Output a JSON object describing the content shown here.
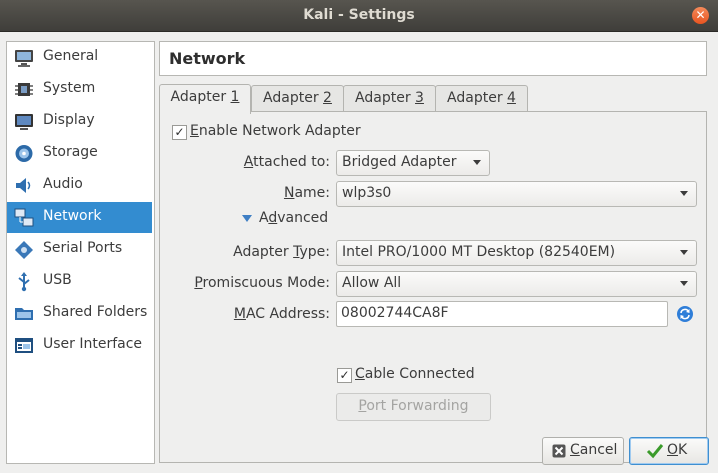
{
  "window": {
    "title": "Kali - Settings",
    "close_glyph": "✕"
  },
  "sidebar": {
    "items": [
      {
        "label": "General",
        "icon": "monitor-general-icon"
      },
      {
        "label": "System",
        "icon": "chip-icon"
      },
      {
        "label": "Display",
        "icon": "display-icon"
      },
      {
        "label": "Storage",
        "icon": "storage-disk-icon"
      },
      {
        "label": "Audio",
        "icon": "speaker-icon"
      },
      {
        "label": "Network",
        "icon": "network-icon",
        "selected": true
      },
      {
        "label": "Serial Ports",
        "icon": "serial-port-icon"
      },
      {
        "label": "USB",
        "icon": "usb-icon"
      },
      {
        "label": "Shared Folders",
        "icon": "folder-icon"
      },
      {
        "label": "User Interface",
        "icon": "user-interface-icon"
      }
    ]
  },
  "section_title": "Network",
  "tabs": [
    {
      "pre": "Adapter ",
      "key": "1",
      "active": true
    },
    {
      "pre": "Adapter ",
      "key": "2"
    },
    {
      "pre": "Adapter ",
      "key": "3"
    },
    {
      "pre": "Adapter ",
      "key": "4"
    }
  ],
  "adapter": {
    "enable_pre": "",
    "enable_key": "E",
    "enable_post": "nable Network Adapter",
    "enabled": true,
    "attached_label_key": "A",
    "attached_label_post": "ttached to:",
    "attached_value": "Bridged Adapter",
    "name_label_key": "N",
    "name_label_post": "ame:",
    "name_value": "wlp3s0",
    "advanced_pre": "A",
    "advanced_key": "d",
    "advanced_post": "vanced",
    "type_label_pre": "Adapter ",
    "type_label_key": "T",
    "type_label_post": "ype:",
    "type_value": "Intel PRO/1000 MT Desktop (82540EM)",
    "promisc_label_key": "P",
    "promisc_label_post": "romiscuous Mode:",
    "promisc_value": "Allow All",
    "mac_label_key": "M",
    "mac_label_post": "AC Address:",
    "mac_value": "08002744CA8F",
    "cable_key": "C",
    "cable_post": "able Connected",
    "cable_connected": true,
    "port_forwarding_key": "P",
    "port_forwarding_post": "ort Forwarding"
  },
  "footer": {
    "cancel_key": "C",
    "cancel_post": "ancel",
    "cancel_icon": "cancel-x-icon",
    "ok_key": "O",
    "ok_post": "K",
    "ok_icon": "ok-check-icon"
  },
  "colors": {
    "selection": "#338cd0",
    "accent_orange": "#e95420"
  }
}
